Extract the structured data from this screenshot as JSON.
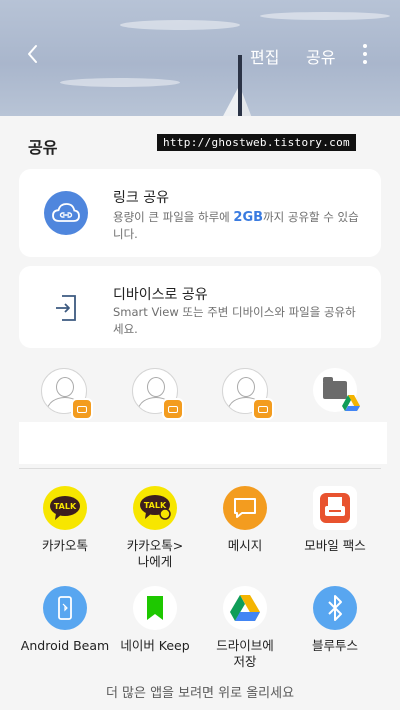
{
  "header": {
    "edit_label": "편집",
    "share_label": "공유"
  },
  "sheet": {
    "title": "공유",
    "url_overlay": "http://ghostweb.tistory.com",
    "link_share": {
      "title": "링크 공유",
      "desc_before": "용량이 큰 파일을 하루에 ",
      "desc_highlight": "2GB",
      "desc_after": "까지 공유할 수 있습니다."
    },
    "device_share": {
      "title": "디바이스로 공유",
      "desc": "Smart View 또는 주변 디바이스와 파일을 공유하세요."
    }
  },
  "contacts": [
    {
      "icon": "contact-avatar-icon",
      "badge": "message-badge-icon"
    },
    {
      "icon": "contact-avatar-icon",
      "badge": "message-badge-icon"
    },
    {
      "icon": "contact-avatar-icon",
      "badge": "message-badge-icon"
    },
    {
      "icon": "folder-icon",
      "badge": "google-drive-icon"
    }
  ],
  "apps": [
    {
      "label": "카카오톡",
      "icon": "kakaotalk-icon"
    },
    {
      "label": "카카오톡>\n나에게",
      "icon": "kakaotalk-me-icon"
    },
    {
      "label": "메시지",
      "icon": "messages-icon"
    },
    {
      "label": "모바일 팩스",
      "icon": "mobile-fax-icon"
    },
    {
      "label": "Android Beam",
      "icon": "android-beam-icon"
    },
    {
      "label": "네이버 Keep",
      "icon": "naver-keep-icon"
    },
    {
      "label": "드라이브에\n저장",
      "icon": "google-drive-icon"
    },
    {
      "label": "블루투스",
      "icon": "bluetooth-icon"
    }
  ],
  "footer_hint": "더 많은 앱을 보려면 위로 올리세요",
  "colors": {
    "accent_blue": "#3a7be0",
    "kakao_yellow": "#f7e600",
    "message_orange": "#f39c1f",
    "naver_green": "#1ec800",
    "bluetooth_blue": "#58a6f0"
  }
}
